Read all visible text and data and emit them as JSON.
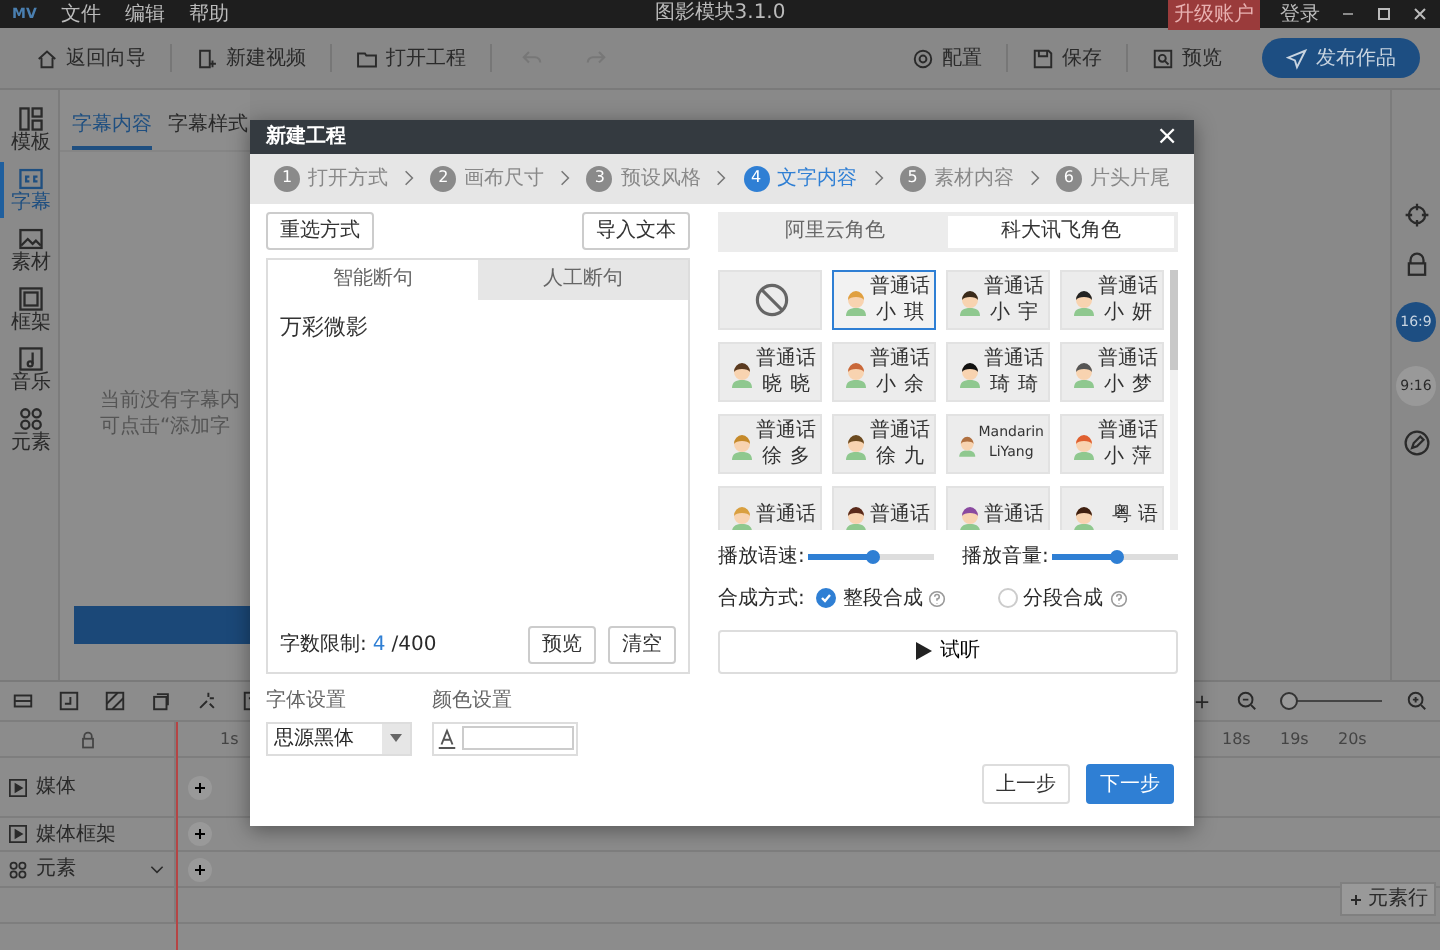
{
  "titlebar": {
    "logo": "MV",
    "menus": [
      "文件",
      "编辑",
      "帮助"
    ],
    "title": "图影模块3.1.0",
    "upgrade": "升级账户",
    "login": "登录"
  },
  "toolbar": {
    "left": [
      {
        "kind": "home",
        "label": "返回向导"
      },
      {
        "kind": "new",
        "label": "新建视频"
      },
      {
        "kind": "open",
        "label": "打开工程"
      }
    ],
    "right": [
      {
        "kind": "config",
        "label": "配置"
      },
      {
        "kind": "save",
        "label": "保存"
      },
      {
        "kind": "preview",
        "label": "预览"
      }
    ],
    "publish": "发布作品"
  },
  "sidebar": {
    "items": [
      {
        "kind": "template",
        "label": "模板",
        "selected": false
      },
      {
        "kind": "subtitle",
        "label": "字幕",
        "selected": true
      },
      {
        "kind": "material",
        "label": "素材",
        "selected": false
      },
      {
        "kind": "frame",
        "label": "框架",
        "selected": false
      },
      {
        "kind": "music",
        "label": "音乐",
        "selected": false
      },
      {
        "kind": "element",
        "label": "元素",
        "selected": false
      }
    ]
  },
  "panel": {
    "tabs": [
      {
        "label": "字幕内容",
        "selected": true
      },
      {
        "label": "字幕样式",
        "selected": false
      }
    ],
    "empty_lines": [
      "当前没有字幕内",
      "可点击“添加字"
    ]
  },
  "canvas_tools": {
    "ratios": [
      {
        "label": "16:9",
        "selected": true
      },
      {
        "label": "9:16",
        "selected": false
      }
    ]
  },
  "timeline": {
    "ticks": [
      "1s",
      "18s",
      "19s",
      "20s"
    ],
    "tracks": [
      {
        "kind": "media",
        "label": "媒体"
      },
      {
        "kind": "media",
        "label": "媒体框架"
      },
      {
        "kind": "element",
        "label": "元素"
      }
    ],
    "add_row": "元素行",
    "zoom": {
      "level": 0
    }
  },
  "dialog": {
    "title": "新建工程",
    "close": "×",
    "steps": [
      {
        "number": "1",
        "label": "打开方式",
        "selected": false
      },
      {
        "number": "2",
        "label": "画布尺寸",
        "selected": false
      },
      {
        "number": "3",
        "label": "预设风格",
        "selected": false
      },
      {
        "number": "4",
        "label": "文字内容",
        "selected": true
      },
      {
        "number": "5",
        "label": "素材内容",
        "selected": false
      },
      {
        "number": "6",
        "label": "片头片尾",
        "selected": false
      }
    ],
    "reselect": "重选方式",
    "import": "导入文本",
    "split_tabs": [
      {
        "label": "智能断句",
        "selected": true
      },
      {
        "label": "人工断句",
        "selected": false
      }
    ],
    "text": "万彩微影",
    "count": {
      "label": "字数限制:",
      "value": "4",
      "limit": "/400"
    },
    "preview": "预览",
    "clear": "清空",
    "font": {
      "label": "字体设置",
      "value": "思源黑体"
    },
    "color": {
      "label": "颜色设置"
    },
    "voice_tabs": [
      {
        "label": "阿里云角色",
        "selected": false
      },
      {
        "label": "科大讯飞角色",
        "selected": true
      }
    ],
    "voices": [
      {
        "kind": "none",
        "selected": false
      },
      {
        "kind": "voice",
        "lang": "普通话",
        "name": "小琪",
        "selected": true
      },
      {
        "kind": "voice",
        "lang": "普通话",
        "name": "小宇",
        "selected": false
      },
      {
        "kind": "voice",
        "lang": "普通话",
        "name": "小妍",
        "selected": false
      },
      {
        "kind": "voice",
        "lang": "普通话",
        "name": "晓晓",
        "selected": false
      },
      {
        "kind": "voice",
        "lang": "普通话",
        "name": "小余",
        "selected": false
      },
      {
        "kind": "voice",
        "lang": "普通话",
        "name": "琦琦",
        "selected": false
      },
      {
        "kind": "voice",
        "lang": "普通话",
        "name": "小梦",
        "selected": false
      },
      {
        "kind": "voice",
        "lang": "普通话",
        "name": "徐多",
        "selected": false
      },
      {
        "kind": "voice",
        "lang": "普通话",
        "name": "徐九",
        "selected": false
      },
      {
        "kind": "voice",
        "lang": "Mandarin",
        "name": "LiYang",
        "selected": false
      },
      {
        "kind": "voice",
        "lang": "普通话",
        "name": "小萍",
        "selected": false
      },
      {
        "kind": "voice",
        "lang": "普通话",
        "selected": false
      },
      {
        "kind": "voice",
        "lang": "普通话",
        "selected": false
      },
      {
        "kind": "voice",
        "lang": "普通话",
        "selected": false
      },
      {
        "kind": "voice",
        "lang": "粤 语",
        "selected": false
      }
    ],
    "sliders": [
      {
        "label": "播放语速:",
        "level": 0.5
      },
      {
        "label": "播放音量:",
        "level": 0.5
      }
    ],
    "synthesis": {
      "label": "合成方式:",
      "options": [
        {
          "label": "整段合成",
          "selected": true
        },
        {
          "label": "分段合成",
          "selected": false
        }
      ]
    },
    "listen": "试听",
    "prev": "上一步",
    "next": "下一步"
  }
}
